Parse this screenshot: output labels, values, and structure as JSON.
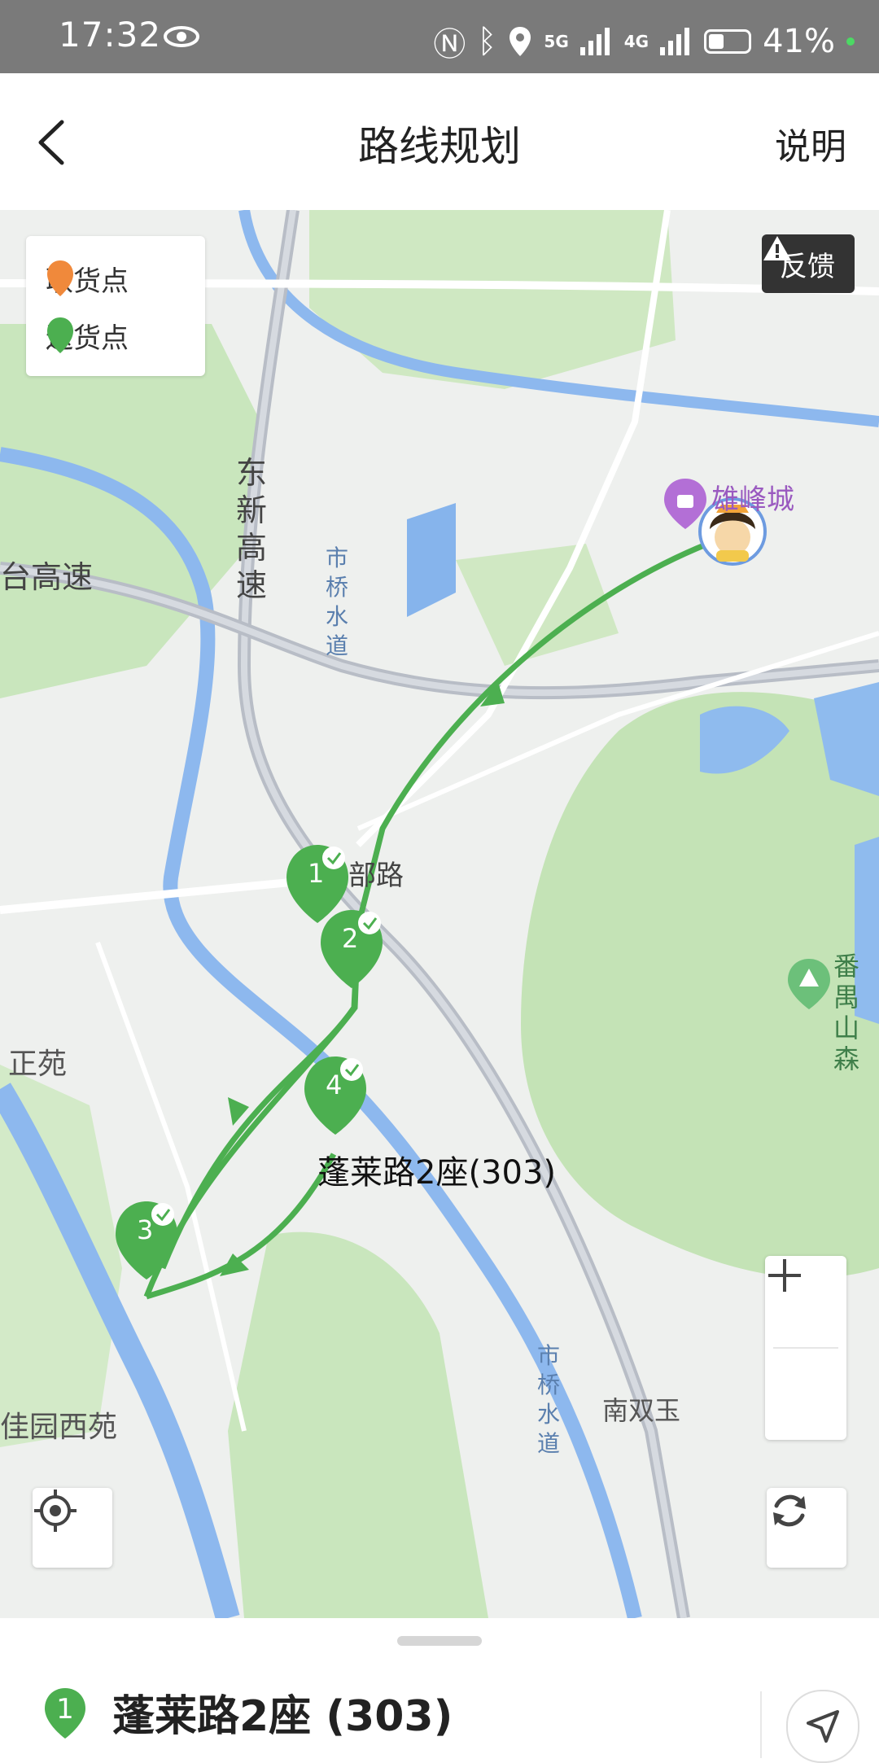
{
  "status_bar": {
    "time": "17:32",
    "network_5g": "5G",
    "network_4g": "4G",
    "battery": "41%"
  },
  "header": {
    "title": "路线规划",
    "help_label": "说明"
  },
  "legend": {
    "pickup_label": "取货点",
    "delivery_label": "送货点",
    "pickup_color": "#f0893b",
    "delivery_color": "#4caf50"
  },
  "feedback_label": "反馈",
  "map": {
    "road_labels": [
      "东新高速",
      "台高速",
      "市桥水道",
      "部路",
      "正苑",
      "佳园西苑",
      "南双玉",
      "市桥水道",
      "番禺山森"
    ],
    "poi_name": "雄峰城",
    "route_color": "#4caf50",
    "stops": [
      {
        "number": "1",
        "status": "done"
      },
      {
        "number": "2",
        "status": "done"
      },
      {
        "number": "3",
        "status": "done"
      },
      {
        "number": "4",
        "status": "done"
      }
    ],
    "selected_stop_label": "蓬莱路2座(303)"
  },
  "bottom_sheet": {
    "stop_number": "1",
    "destination": "蓬莱路2座 (303)"
  }
}
